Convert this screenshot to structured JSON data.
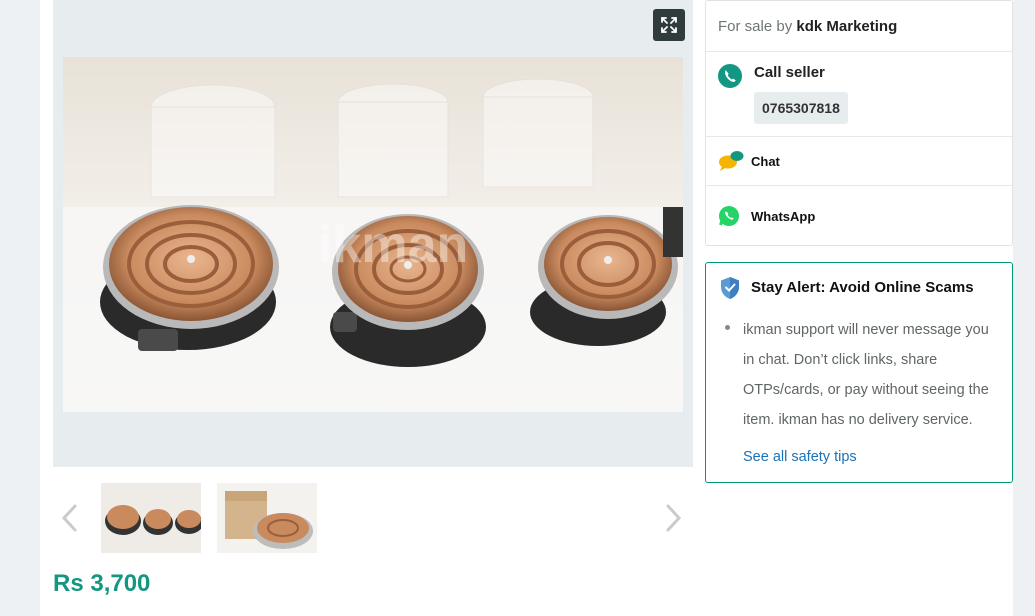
{
  "gallery": {
    "fullscreen_icon": "expand-icon",
    "watermark": "ikman",
    "prev_icon": "chevron-left-icon",
    "next_icon": "chevron-right-icon",
    "thumbnails": [
      "hot-plates-photo",
      "boxed-hot-plate-photo"
    ]
  },
  "price": "Rs 3,700",
  "seller": {
    "for_sale_by": "For sale by",
    "name": "kdk Marketing",
    "call_label": "Call seller",
    "phone": "0765307818",
    "chat_label": "Chat",
    "whatsapp_label": "WhatsApp"
  },
  "safety": {
    "title": "Stay Alert: Avoid Online Scams",
    "tip": "ikman support will never message you in chat. Don’t click links, share OTPs/cards, or pay without seeing the item. ikman has no delivery service.",
    "link": "See all safety tips"
  },
  "colors": {
    "accent": "#149782",
    "link": "#1a73b8",
    "whatsapp": "#25d366"
  }
}
